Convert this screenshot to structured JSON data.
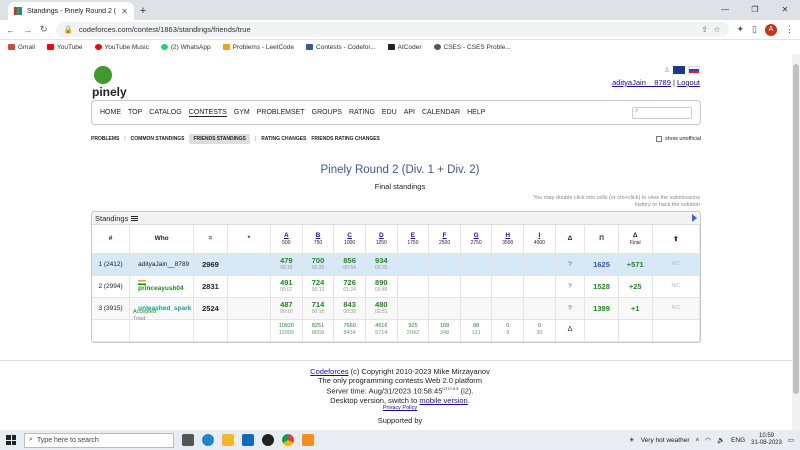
{
  "browser": {
    "tab_title": "Standings - Pinely Round 2 (Div.",
    "tab_close": "✕",
    "new_tab": "+",
    "url": "codeforces.com/contest/1863/standings/friends/true",
    "profile_initial": "A",
    "bookmarks": [
      {
        "label": "Gmail",
        "color": "#d44638"
      },
      {
        "label": "YouTube",
        "color": "#ff0000"
      },
      {
        "label": "YouTube Music",
        "color": "#ff0000"
      },
      {
        "label": "(2) WhatsApp",
        "color": "#25d366"
      },
      {
        "label": "Problems - LeetCode",
        "color": "#f89f1b"
      },
      {
        "label": "Contests - Codefor...",
        "color": "#3b5998"
      },
      {
        "label": "AtCoder",
        "color": "#222222"
      },
      {
        "label": "CSES - CSES Proble...",
        "color": "#555555"
      }
    ]
  },
  "header": {
    "logo_text": "pinely",
    "username": "adityaJain__8789",
    "separator": "|",
    "logout": "Logout"
  },
  "menu": {
    "items": [
      "HOME",
      "TOP",
      "CATALOG",
      "CONTESTS",
      "GYM",
      "PROBLEMSET",
      "GROUPS",
      "RATING",
      "EDU",
      "API",
      "CALENDAR",
      "HELP"
    ],
    "active": "CONTESTS"
  },
  "subnav": {
    "problems": "PROBLEMS",
    "common": "COMMON STANDINGS",
    "friends": "FRIENDS STANDINGS",
    "rating_changes": "RATING CHANGES",
    "friends_rating": "FRIENDS RATING CHANGES",
    "sep": "|",
    "show_unofficial": "show unofficial"
  },
  "contest": {
    "title": "Pinely Round 2 (Div. 1 + Div. 2)",
    "subtitle": "Final standings",
    "hint": "You may double click into cells (or ctrl+click) to view the submissions history or hack the solution"
  },
  "standings": {
    "label": "Standings",
    "headers": {
      "rank": "#",
      "who": "Who",
      "points": "=",
      "penalty": "*",
      "delta_q": "Δ",
      "perf": "Π",
      "final_label": "Final",
      "final_symbol": "Δ",
      "sort": "⬆"
    },
    "problems": [
      {
        "letter": "A",
        "score": "500"
      },
      {
        "letter": "B",
        "score": "750"
      },
      {
        "letter": "C",
        "score": "1000"
      },
      {
        "letter": "D",
        "score": "1250"
      },
      {
        "letter": "E",
        "score": "1750"
      },
      {
        "letter": "F",
        "score": "2500"
      },
      {
        "letter": "G",
        "score": "2750"
      },
      {
        "letter": "H",
        "score": "3500"
      },
      {
        "letter": "I",
        "score": "4000"
      }
    ],
    "rows": [
      {
        "rank": "1 (2412)",
        "handle": "adityaJain__8789",
        "points": "2969",
        "cells": [
          [
            "479",
            "00:16"
          ],
          [
            "700",
            "00:25"
          ],
          [
            "856",
            "00:54"
          ],
          [
            "934",
            "00:35"
          ]
        ],
        "q": "?",
        "perf": "1625",
        "delta": "+571",
        "na": "N/C"
      },
      {
        "rank": "2 (2994)",
        "handle": "princeayush04",
        "points": "2831",
        "cells": [
          [
            "491",
            "00:07"
          ],
          [
            "724",
            "00:13"
          ],
          [
            "726",
            "01:24"
          ],
          [
            "890",
            "00:48"
          ]
        ],
        "q": "?",
        "perf": "1528",
        "delta": "+25",
        "na": "N/C"
      },
      {
        "rank": "3 (3915)",
        "handle": "unleashed_spark",
        "points": "2524",
        "cells": [
          [
            "487",
            "00:10"
          ],
          [
            "714",
            "00:16"
          ],
          [
            "843",
            "00:39"
          ],
          [
            "480",
            "02:51"
          ]
        ],
        "q": "?",
        "perf": "1399",
        "delta": "+1",
        "na": "N/C"
      }
    ],
    "footer": {
      "accepted_label": "Accepted",
      "tried_label": "Tried",
      "accepted": [
        "10920",
        "8251",
        "7660",
        "4516",
        "925",
        "168",
        "88",
        "0",
        "0"
      ],
      "tried": [
        "12905",
        "8659",
        "8434",
        "5714",
        "2042",
        "348",
        "131",
        "9",
        "30"
      ],
      "delta": "Δ"
    }
  },
  "footer": {
    "codeforces": "Codeforces",
    "copyright": " (c) Copyright 2010-2023 Mike Mirzayanov",
    "platform": "The only programming contests Web 2.0 platform",
    "server_time": "Server time: Aug/31/2023 10:58:45",
    "server_suffix": "UTC+5.5",
    "server_tail": " (i2).",
    "desktop_prefix": "Desktop version, switch to ",
    "mobile": "mobile version",
    "desktop_suffix": ".",
    "privacy": "Privacy Policy",
    "supported_by": "Supported by"
  },
  "taskbar": {
    "search_placeholder": "Type here to search",
    "weather": "Very hot weather",
    "lang": "ENG",
    "time": "10:59",
    "date": "31-08-2023"
  }
}
